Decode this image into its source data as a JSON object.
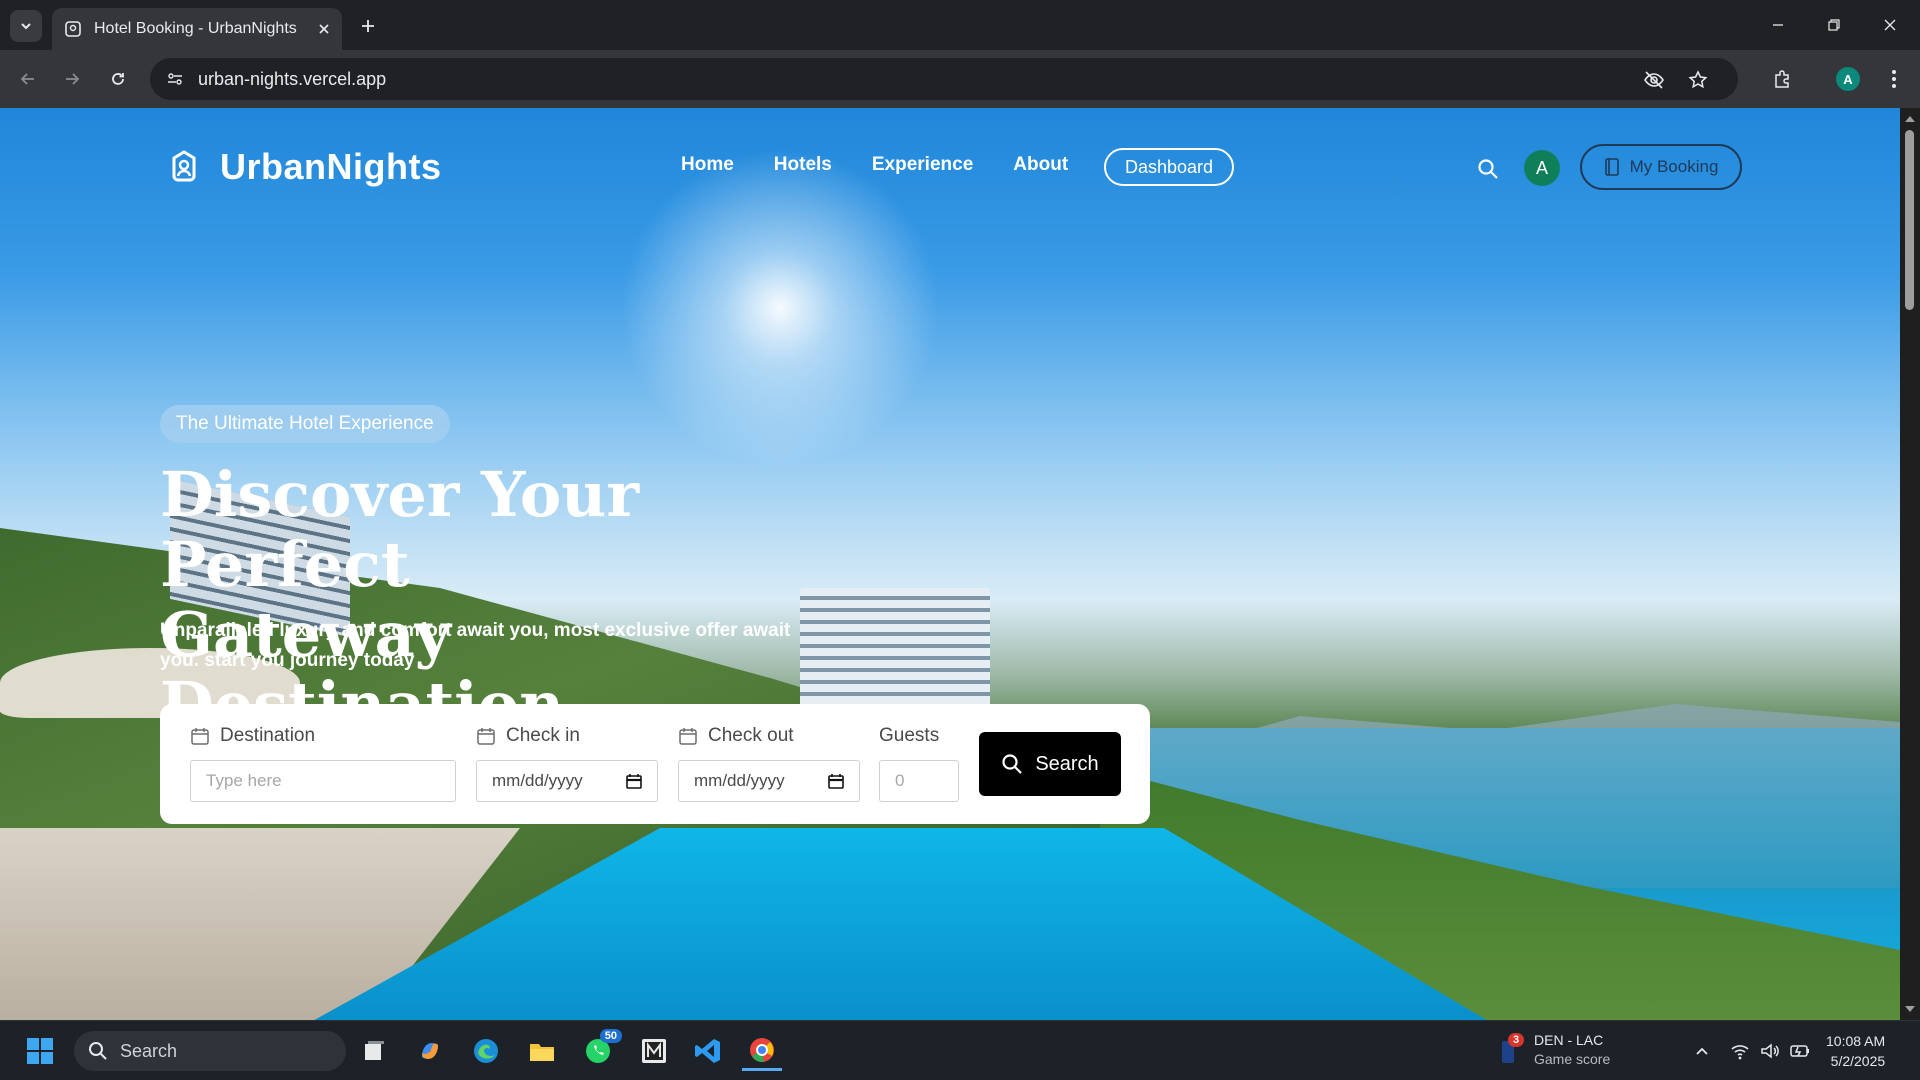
{
  "browser": {
    "tab_title": "Hotel Booking - UrbanNights",
    "url": "urban-nights.vercel.app",
    "profile_initial": "A"
  },
  "site": {
    "brand": "UrbanNights",
    "nav": [
      {
        "label": "Home"
      },
      {
        "label": "Hotels"
      },
      {
        "label": "Experience"
      },
      {
        "label": "About"
      }
    ],
    "dashboard_label": "Dashboard",
    "avatar_initial": "A",
    "my_booking_label": "My Booking"
  },
  "hero": {
    "badge": "The Ultimate Hotel Experience",
    "title_line1": "Discover Your Perfect",
    "title_line2": "Gateway Destination",
    "subtitle": "Unparalleled luxury and comfort await you, most exclusive offer await you. start you journey today"
  },
  "booking": {
    "destination_label": "Destination",
    "destination_placeholder": "Type here",
    "checkin_label": "Check in",
    "checkin_value": "mm/dd/yyyy",
    "checkout_label": "Check out",
    "checkout_value": "mm/dd/yyyy",
    "guests_label": "Guests",
    "guests_placeholder": "0",
    "search_label": "Search"
  },
  "taskbar": {
    "search_placeholder": "Search",
    "whatsapp_badge": "50",
    "score_badge": "3",
    "score_title": "DEN - LAC",
    "score_sub": "Game score",
    "time": "10:08 AM",
    "date": "5/2/2025"
  },
  "colors": {
    "accent_dark": "#000000",
    "brand_outline": "#1e3a57",
    "avatar_green": "#0f7f5a"
  }
}
